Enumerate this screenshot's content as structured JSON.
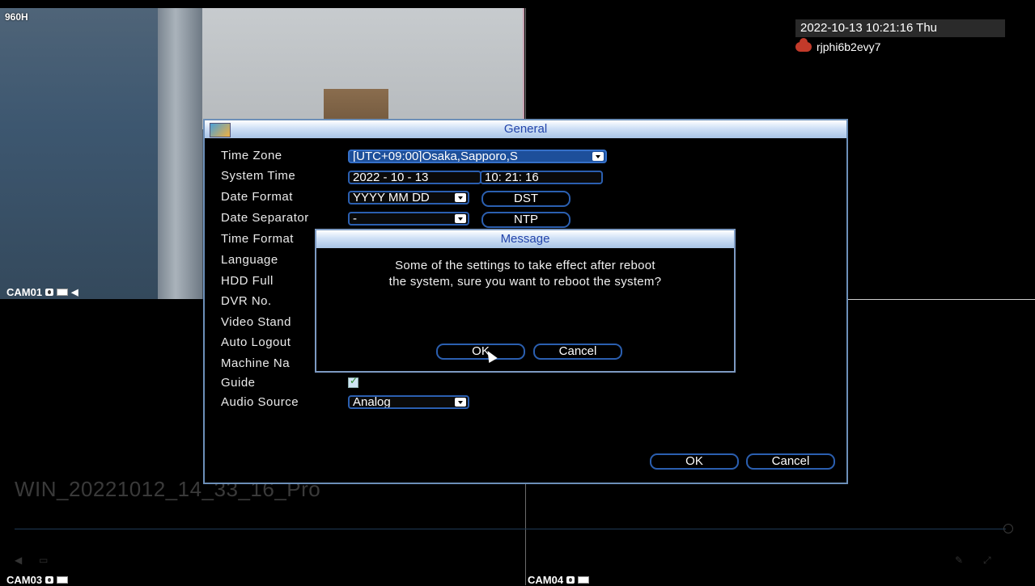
{
  "cameras": {
    "cam1": {
      "top_label": "960H",
      "bottom_label": "CAM01"
    },
    "cam3": {
      "label": "CAM03"
    },
    "cam4": {
      "label": "CAM04"
    }
  },
  "status": {
    "datetime": "2022-10-13 10:21:16 Thu",
    "cloud_id": "rjphi6b2evy7"
  },
  "player": {
    "title": "WIN_20221012_14_33_16_Pro"
  },
  "general_dialog": {
    "title": "General",
    "labels": {
      "time_zone": "Time Zone",
      "system_time": "System Time",
      "date_format": "Date Format",
      "date_separator": "Date Separator",
      "time_format": "Time Format",
      "language": "Language",
      "hdd_full": "HDD Full",
      "dvr_no": "DVR No.",
      "video_standard": "Video Stand",
      "auto_logout": "Auto Logout",
      "machine_name": "Machine Na",
      "guide": "Guide",
      "audio_source": "Audio Source"
    },
    "values": {
      "time_zone": "[UTC+09:00]Osaka,Sapporo,S",
      "system_date": "2022 - 10 - 13",
      "system_clock": "10: 21: 16",
      "date_format": "YYYY MM DD",
      "date_separator": "-",
      "audio_source": "Analog"
    },
    "buttons": {
      "dst": "DST",
      "ntp": "NTP",
      "ok": "OK",
      "cancel": "Cancel"
    },
    "guide_checked": true
  },
  "message_dialog": {
    "title": "Message",
    "line1": "Some of the settings to take effect after reboot",
    "line2": "the system, sure you want to reboot the system?",
    "ok": "OK",
    "cancel": "Cancel"
  },
  "colors": {
    "title_text": "#2244aa",
    "border_blue": "#2b5fb0",
    "selected_field": "#1d4f9a"
  }
}
